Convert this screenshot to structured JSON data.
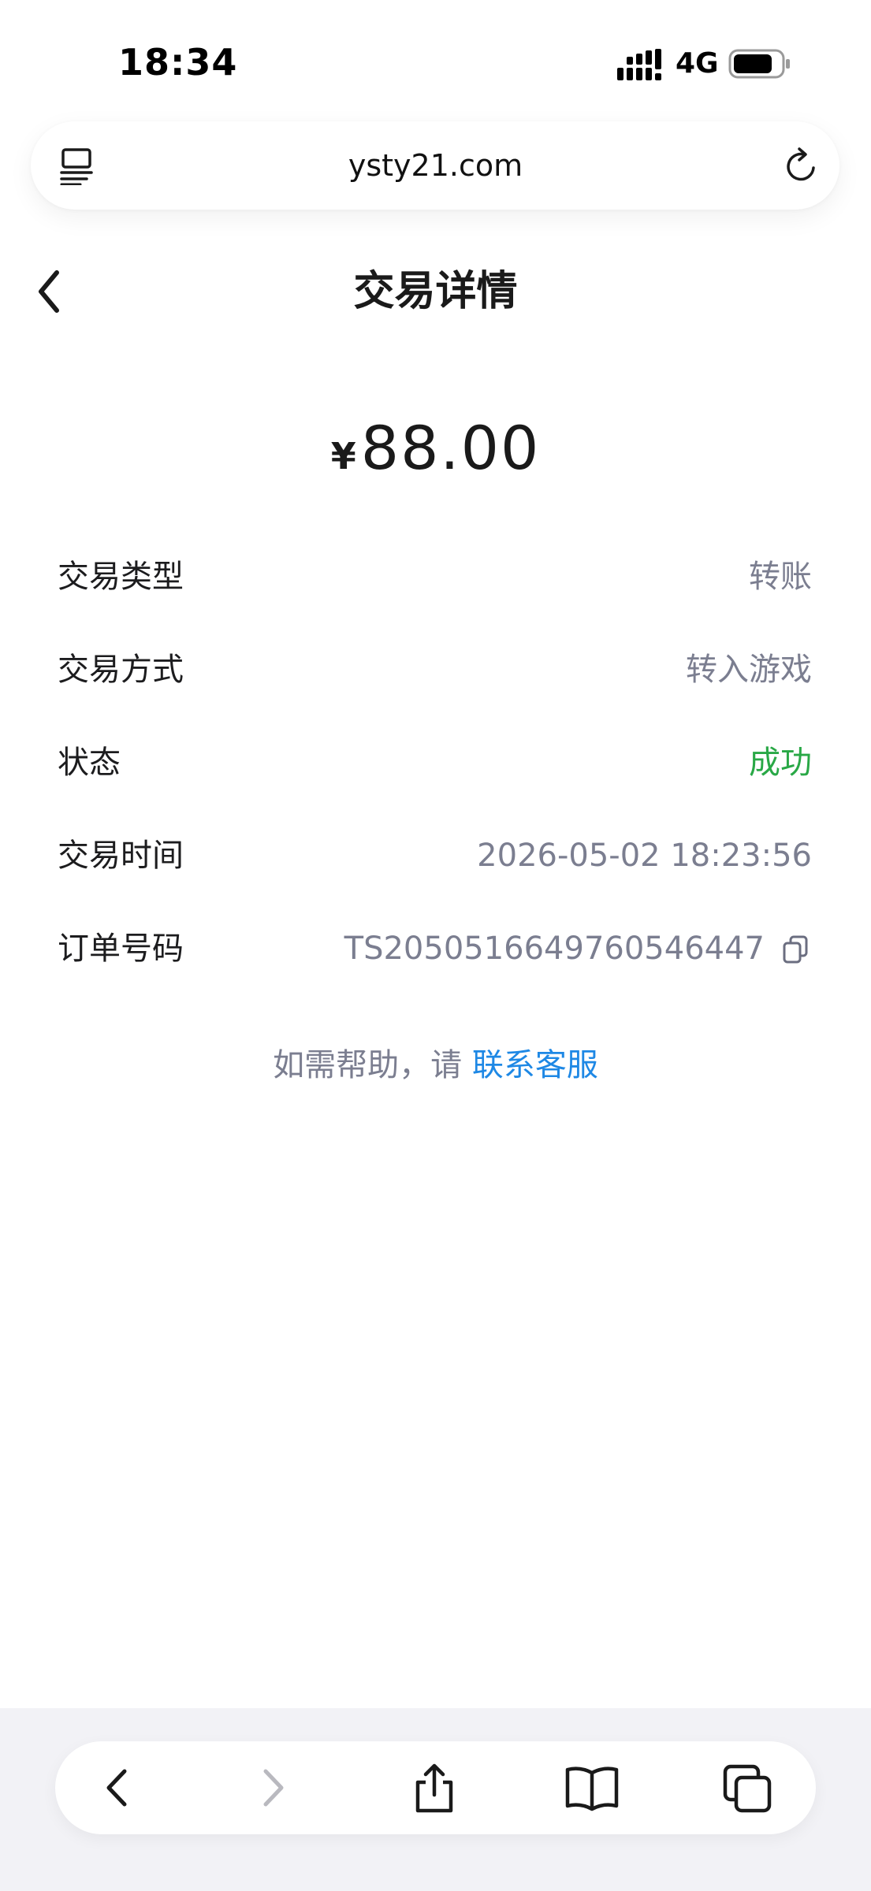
{
  "status_bar": {
    "time": "18:34",
    "network": "4G",
    "signal_icon": "signal-bars-icon",
    "battery_icon": "battery-icon",
    "battery_level": 0.8
  },
  "address_bar": {
    "url": "ysty21.com",
    "left_icon": "reader-view-icon",
    "right_icon": "reload-icon"
  },
  "header": {
    "title": "交易详情",
    "back_icon": "chevron-left-icon"
  },
  "amount": {
    "currency": "¥",
    "value": "88.00"
  },
  "details": {
    "type": {
      "label": "交易类型",
      "value": "转账"
    },
    "method": {
      "label": "交易方式",
      "value": "转入游戏"
    },
    "status": {
      "label": "状态",
      "value": "成功",
      "color": "#29a846"
    },
    "time": {
      "label": "交易时间",
      "value": "2026-05-02 18:23:56"
    },
    "order": {
      "label": "订单号码",
      "value": "TS2050516649760546447",
      "icon": "copy-icon"
    }
  },
  "help": {
    "prefix": "如需帮助，请 ",
    "link": "联系客服",
    "link_color": "#1e88e5"
  },
  "toolbar": {
    "icons": [
      "back-icon",
      "forward-icon",
      "share-icon",
      "bookmarks-icon",
      "tabs-icon"
    ]
  }
}
